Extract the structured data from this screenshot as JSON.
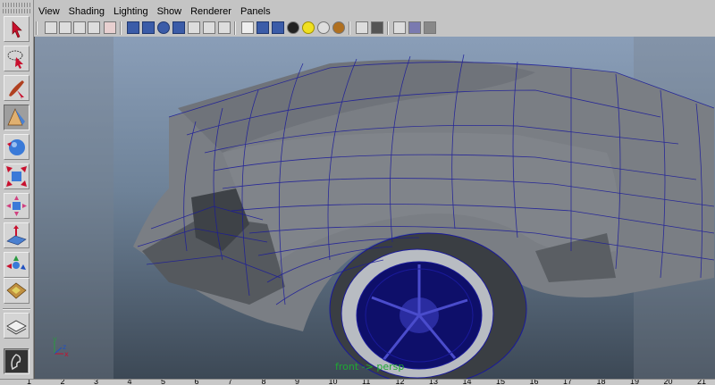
{
  "menu": {
    "items": [
      "View",
      "Shading",
      "Lighting",
      "Show",
      "Renderer",
      "Panels"
    ]
  },
  "toolbox": {
    "tools": [
      {
        "name": "select-tool",
        "icon": "arrow-select-icon"
      },
      {
        "name": "lasso-tool",
        "icon": "lasso-icon"
      },
      {
        "name": "paint-select-tool",
        "icon": "paint-brush-icon"
      },
      {
        "name": "move-tool",
        "icon": "move-icon"
      },
      {
        "name": "rotate-tool",
        "icon": "rotate-icon"
      },
      {
        "name": "scale-tool",
        "icon": "scale-icon"
      },
      {
        "name": "universal-manipulator-tool",
        "icon": "manipulator-icon"
      },
      {
        "name": "soft-modification-tool",
        "icon": "soft-mod-icon"
      },
      {
        "name": "show-manipulator-tool",
        "icon": "show-manip-icon"
      },
      {
        "name": "last-used-tool",
        "icon": "last-tool-icon"
      },
      {
        "name": "layout-single-pane",
        "icon": "layout-icon"
      },
      {
        "name": "layout-quick",
        "icon": "quick-layout-icon"
      }
    ]
  },
  "viewport": {
    "camera_label": "front -> persp",
    "axis": {
      "x": "x",
      "y": "y",
      "z": "z"
    },
    "colors": {
      "wire": "#1a1a9a",
      "surface": "#7a7e84",
      "gate": "#8c949a"
    }
  },
  "timeslider": {
    "ticks": [
      "1",
      "2",
      "3",
      "4",
      "5",
      "6",
      "7",
      "8",
      "9",
      "10",
      "11",
      "12",
      "13",
      "14",
      "15",
      "16",
      "17",
      "18",
      "19",
      "20",
      "21"
    ]
  }
}
